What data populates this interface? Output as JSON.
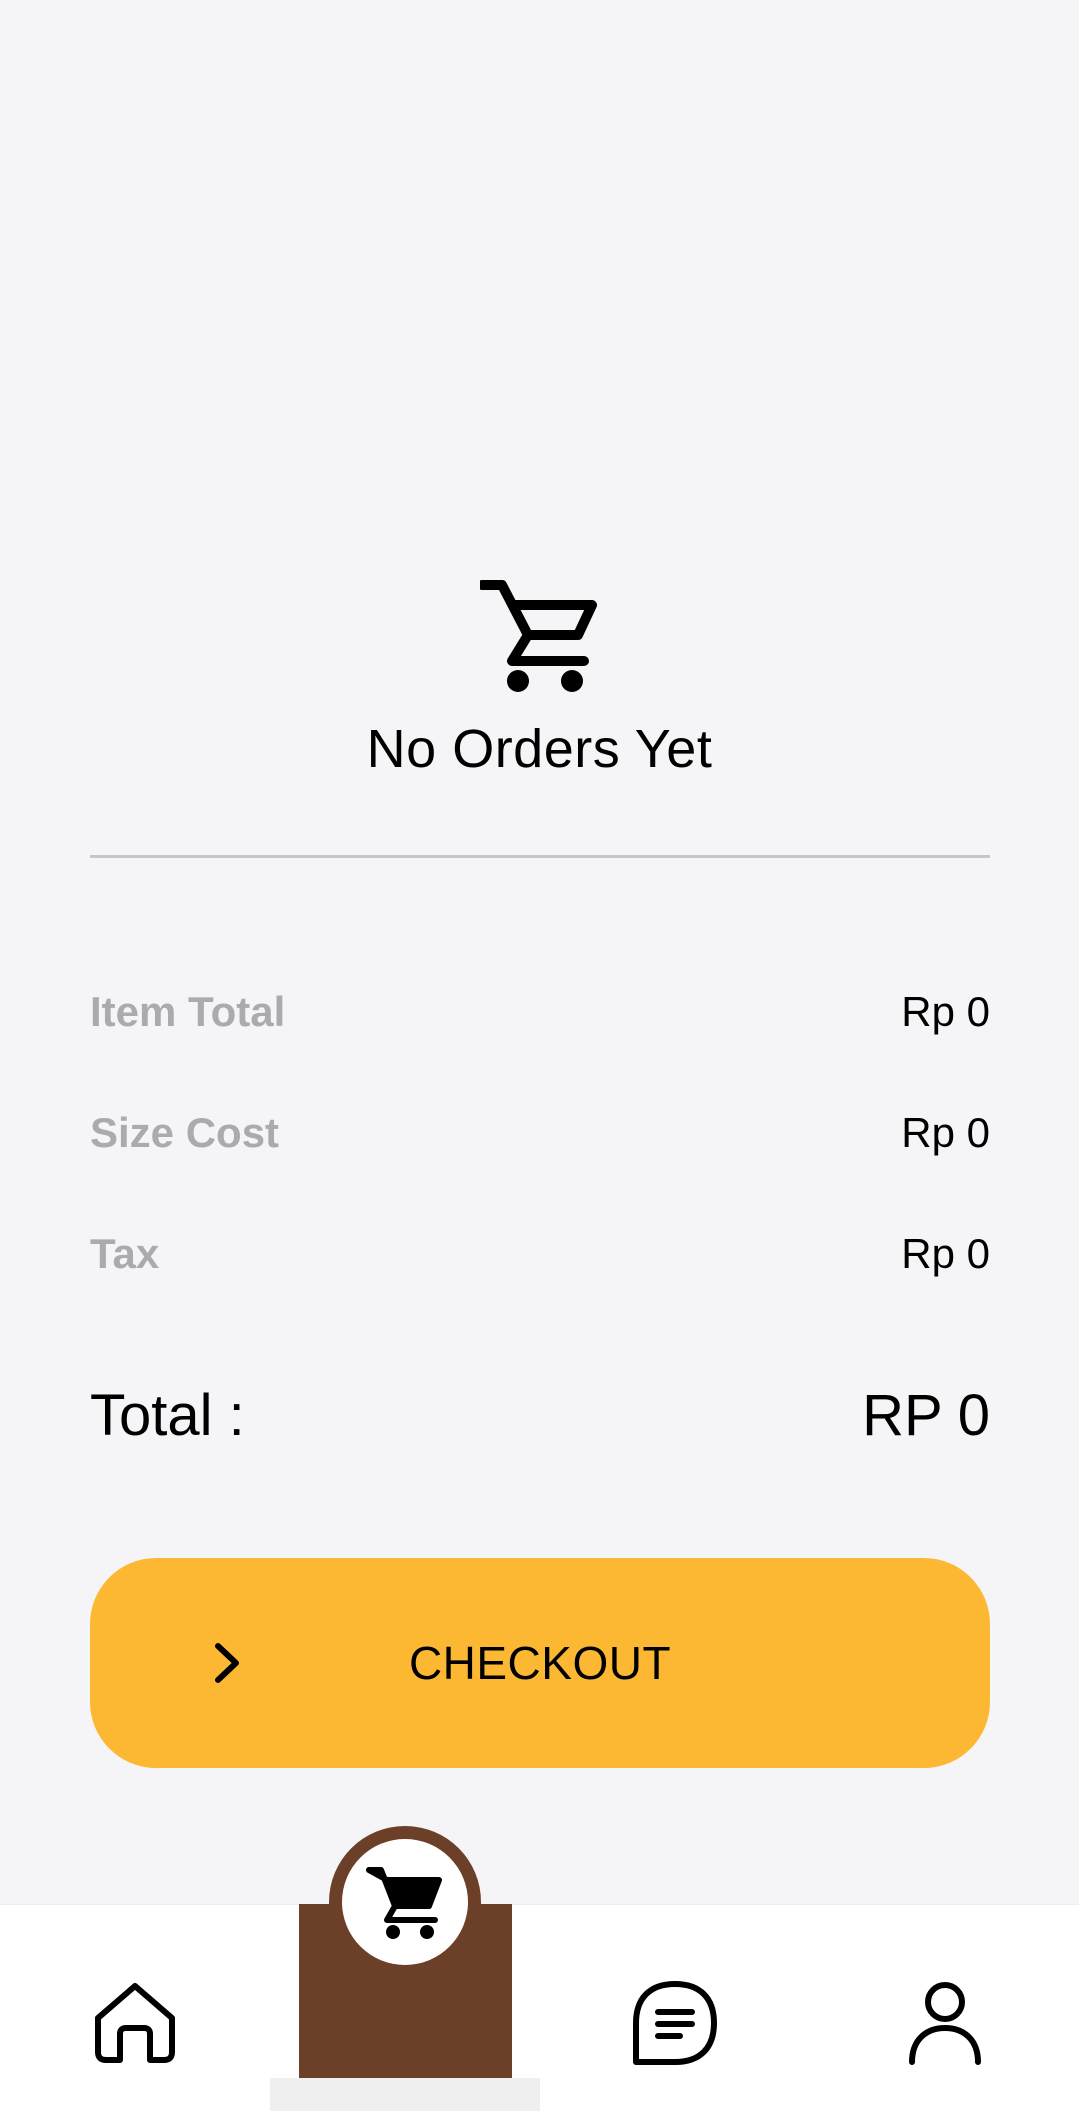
{
  "empty_state": {
    "icon": "shopping-cart-icon",
    "title": "No Orders Yet"
  },
  "summary": {
    "rows": [
      {
        "label": "Item Total",
        "value": "Rp 0"
      },
      {
        "label": "Size Cost",
        "value": "Rp 0"
      },
      {
        "label": "Tax",
        "value": "Rp 0"
      }
    ],
    "total_label": "Total :",
    "total_value": "RP 0"
  },
  "checkout": {
    "label": "CHECKOUT",
    "icon": "chevron-right-icon"
  },
  "bottom_nav": {
    "items": [
      {
        "icon": "home-icon",
        "active": false
      },
      {
        "icon": "shopping-cart-icon",
        "active": true
      },
      {
        "icon": "menu-list-icon",
        "active": false
      },
      {
        "icon": "profile-icon",
        "active": false
      }
    ]
  },
  "colors": {
    "background": "#f5f5f7",
    "accent": "#fdb833",
    "brand_brown": "#6b3f28",
    "muted_label": "#ababae"
  }
}
